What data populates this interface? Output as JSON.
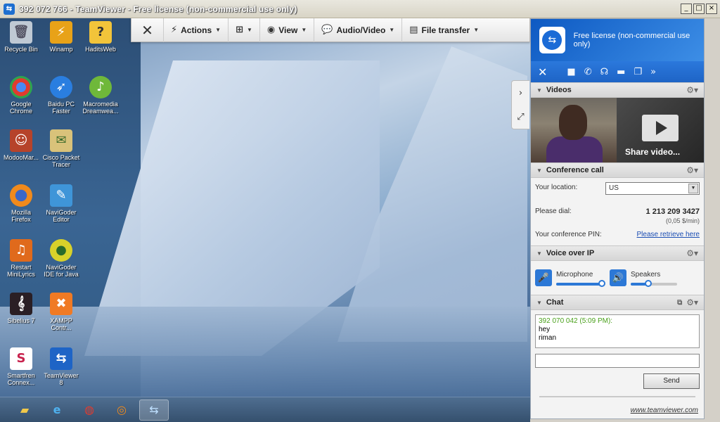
{
  "window": {
    "title": "392 072 766 - TeamViewer - Free license (non-commercial use only)",
    "buttons": [
      "_",
      "□",
      "×"
    ]
  },
  "toolbar": {
    "close_icon": "close-icon",
    "items": [
      {
        "label": "Actions",
        "icon": "lightning-icon"
      },
      {
        "label": "",
        "icon": "windows-icon"
      },
      {
        "label": "View",
        "icon": "eye-icon"
      },
      {
        "label": "Audio/Video",
        "icon": "chat-bubbles-icon"
      },
      {
        "label": "File transfer",
        "icon": "file-icon"
      }
    ]
  },
  "desktop_icons": [
    {
      "label": "Recycle Bin"
    },
    {
      "label": "Winamp"
    },
    {
      "label": "HaditsWeb"
    },
    {
      "label": "Google Chrome"
    },
    {
      "label": "Baidu PC Faster"
    },
    {
      "label": "Macromedia Dreamwea..."
    },
    {
      "label": "ModooMar..."
    },
    {
      "label": "Cisco Packet Tracer"
    },
    {
      "label": "Mozilla Firefox"
    },
    {
      "label": "NaviGoder Editor"
    },
    {
      "label": "Restart MiniLyrics"
    },
    {
      "label": "NaviGoder IDE for Java"
    },
    {
      "label": "Sibelius 7"
    },
    {
      "label": "XAMPP Contr..."
    },
    {
      "label": "Smartfren Connex..."
    },
    {
      "label": "TeamViewer 8"
    }
  ],
  "taskbar": {
    "apps": [
      "file-explorer-icon",
      "internet-explorer-icon",
      "chrome-icon",
      "firefox-icon",
      "teamviewer-icon"
    ],
    "active_index": 4
  },
  "panel": {
    "license_text": "Free license (non-commercial use only)",
    "tool_icons": [
      "close-icon",
      "video-camera-icon",
      "phone-icon",
      "headset-icon",
      "chat-icon",
      "file-transfer-icon",
      "more-icon"
    ],
    "videos": {
      "title": "Videos",
      "share_label": "Share video..."
    },
    "conference": {
      "title": "Conference call",
      "location_label": "Your location:",
      "location_value": "US",
      "dial_label": "Please dial:",
      "dial_number": "1 213 209 3427",
      "rate": "(0,05 $/min)",
      "pin_label": "Your conference PIN:",
      "pin_link": "Please retrieve here"
    },
    "voip": {
      "title": "Voice over IP",
      "mic_label": "Microphone",
      "mic_level": 1.0,
      "speakers_label": "Speakers",
      "speakers_level": 0.4
    },
    "chat": {
      "title": "Chat",
      "messages": [
        {
          "meta": "392 070 042 (5:09 PM):",
          "lines": [
            "hey",
            "riman"
          ]
        }
      ],
      "send_label": "Send"
    },
    "footer_link": "www.teamviewer.com"
  },
  "colors": {
    "teamviewer_blue": "#1e64c6",
    "chat_meta_green": "#49a01a"
  }
}
